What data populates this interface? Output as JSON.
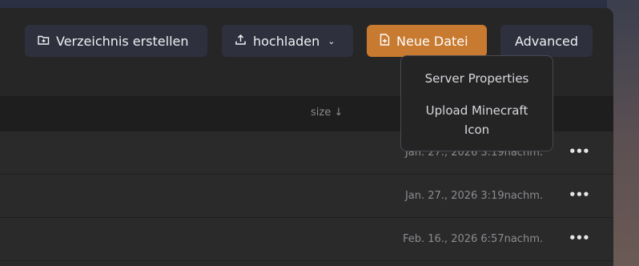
{
  "toolbar": {
    "create_dir_label": "Verzeichnis erstellen",
    "create_dir_icon": "folder-plus-icon",
    "upload_label": "hochladen",
    "upload_icon": "upload-icon",
    "new_file_label": "Neue Datei",
    "new_file_icon": "file-plus-icon",
    "advanced_label": "Advanced"
  },
  "dropdown": {
    "items": [
      {
        "label": "Server Properties"
      },
      {
        "label": "Upload Minecraft Icon"
      }
    ]
  },
  "table": {
    "columns": {
      "size": "size ↓"
    },
    "rows": [
      {
        "date": "Jan. 27., 2026 3:19nachm.",
        "menu": "•••"
      },
      {
        "date": "Jan. 27., 2026 3:19nachm.",
        "menu": "•••"
      },
      {
        "date": "Feb. 16., 2026 6:57nachm.",
        "menu": "•••"
      }
    ]
  },
  "colors": {
    "accent": "#c87a30",
    "panel": "#262626",
    "button": "#2e303e"
  }
}
